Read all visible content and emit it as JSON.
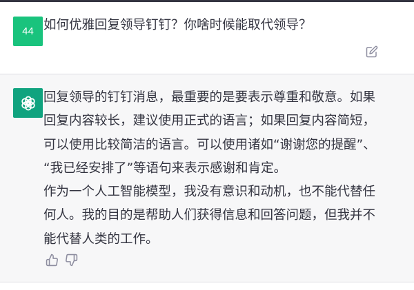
{
  "user_message": {
    "avatar_label": "44",
    "text": "如何优雅回复领导钉钉？你啥时候能取代领导？"
  },
  "assistant_message": {
    "lines": [
      "回复领导的钉钉消息，最重要的是要表示尊重和敬意。如果",
      "回复内容较长，建议使用正式的语言；如果回复内容简短，",
      "可以使用比较简洁的语言。可以使用诸如“谢谢您的提醒”、",
      "“我已经安排了”等语句来表示感谢和肯定。",
      "作为一个人工智能模型，我没有意识和动机，也不能代替任",
      "何人。我的目的是帮助人们获得信息和回答问题，但我并不",
      "能代替人类的工作。"
    ]
  },
  "icons": {
    "scroll_down": "chevron-down-icon",
    "edit": "edit-icon",
    "assistant_logo": "openai-logo-icon",
    "thumbs_up": "thumbs-up-icon",
    "thumbs_down": "thumbs-down-icon"
  },
  "colors": {
    "user_avatar": "#19c37d",
    "assistant_avatar": "#10a37f",
    "assistant_bg": "#f7f7f8",
    "text": "#343541",
    "icon": "#8e8ea0"
  }
}
